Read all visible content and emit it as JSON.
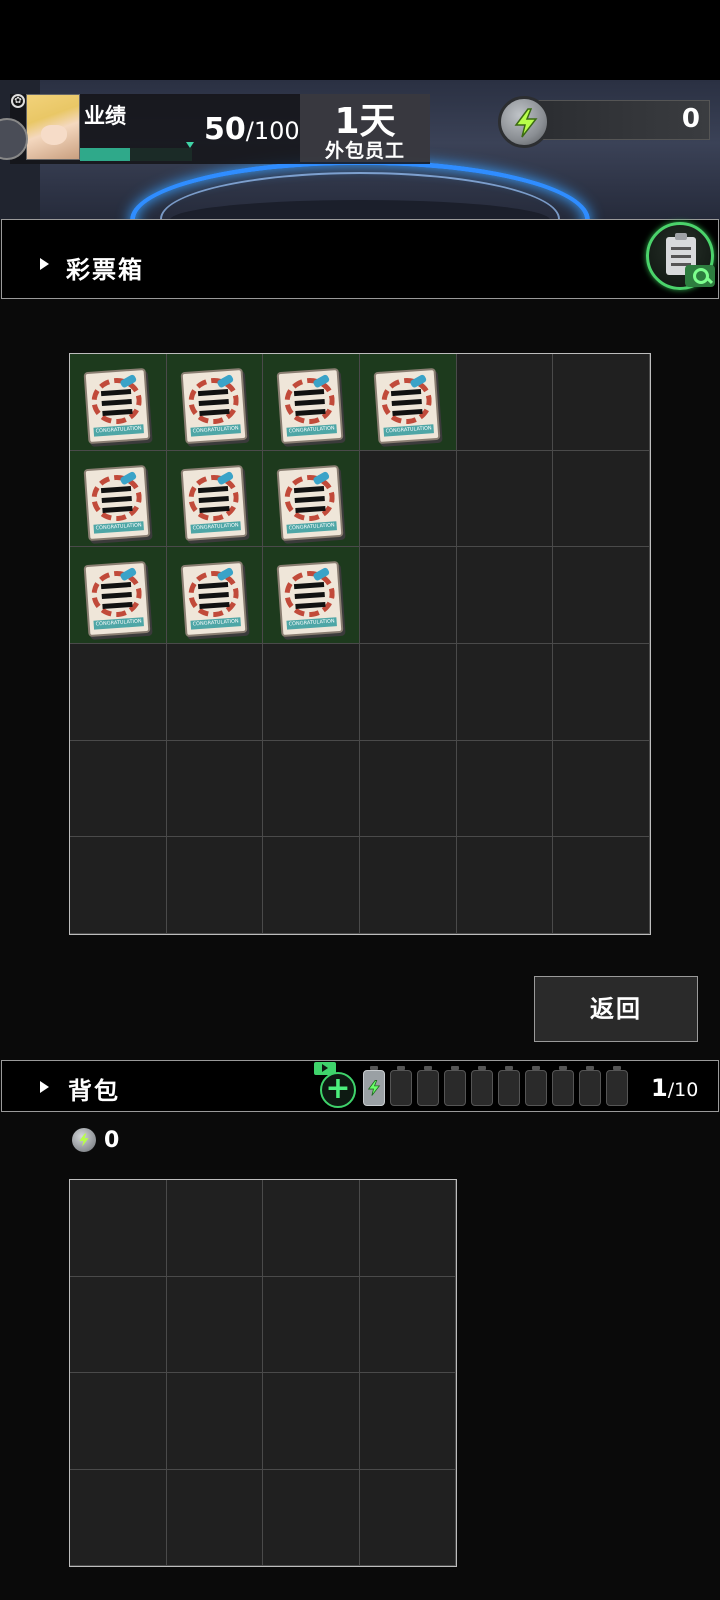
{
  "hud": {
    "performance_label": "业绩",
    "performance_progress": 0.45,
    "performance_score": "50",
    "performance_max": "/100",
    "day_count": "1天",
    "rank_label": "外包员工",
    "energy_value": "0"
  },
  "lottery": {
    "title": "彩票箱",
    "grid_columns": 6,
    "grid_rows": 6,
    "filled_per_row": [
      4,
      3,
      3,
      0,
      0,
      0
    ],
    "ticket_ribbon_text": "CONGRATULATION"
  },
  "return_button": "返回",
  "backpack": {
    "title": "背包",
    "count": "1",
    "capacity": "/10",
    "battery_slots_total": 10,
    "battery_slots_filled": 1,
    "coins": "0",
    "grid_columns": 4,
    "grid_rows": 4
  },
  "colors": {
    "accent_green": "#3fd36b",
    "filled_cell": "#1d3a1d",
    "empty_cell": "#202020",
    "stage_blue": "#2f8dff"
  }
}
